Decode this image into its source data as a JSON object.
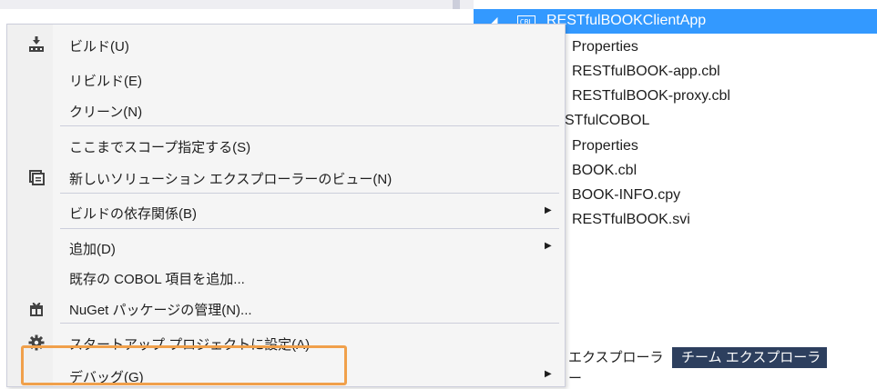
{
  "tree": {
    "root": "RESTfulBOOKClientApp",
    "root_icon": "CBL",
    "items": [
      "Properties",
      "RESTfulBOOK-app.cbl",
      "RESTfulBOOK-proxy.cbl",
      "STfulCOBOL",
      "Properties",
      "BOOK.cbl",
      "BOOK-INFO.cpy",
      "RESTfulBOOK.svi"
    ]
  },
  "tabs": {
    "explorer": "エクスプローラー",
    "team": "チーム エクスプローラー"
  },
  "menu": {
    "build": "ビルド(U)",
    "rebuild": "リビルド(E)",
    "clean": "クリーン(N)",
    "scope": "ここまでスコープ指定する(S)",
    "new_view": "新しいソリューション エクスプローラーのビュー(N)",
    "build_deps": "ビルドの依存関係(B)",
    "add": "追加(D)",
    "add_cobol": "既存の COBOL 項目を追加...",
    "nuget": "NuGet パッケージの管理(N)...",
    "set_startup": "スタートアップ プロジェクトに設定(A)",
    "debug": "デバッグ(G)"
  },
  "colors": {
    "selection": "#3399ff",
    "highlight": "#f0a04b",
    "team_tab": "#2d3f5e"
  }
}
